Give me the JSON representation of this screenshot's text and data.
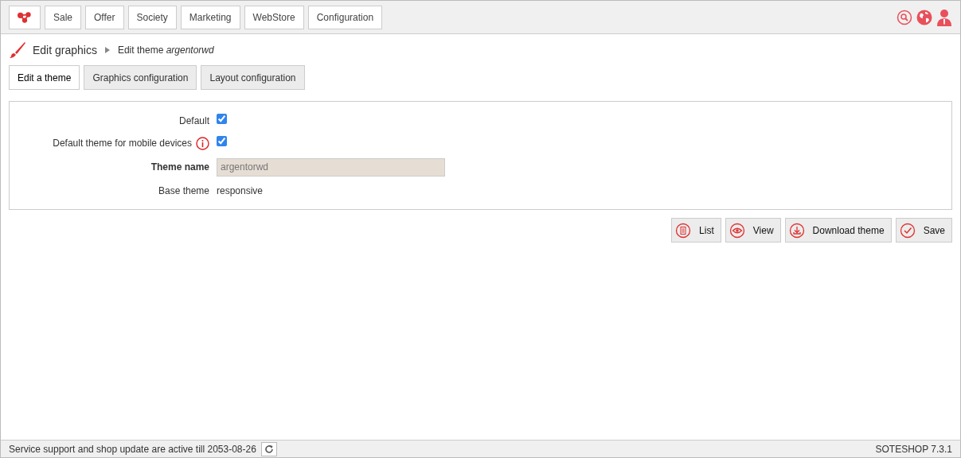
{
  "menu": [
    {
      "label": "Sale"
    },
    {
      "label": "Offer"
    },
    {
      "label": "Society"
    },
    {
      "label": "Marketing"
    },
    {
      "label": "WebStore"
    },
    {
      "label": "Configuration"
    }
  ],
  "breadcrumb": {
    "title": "Edit graphics",
    "current": "Edit theme *argentorwd*"
  },
  "tabs": [
    {
      "label": "Edit a theme",
      "selected": true
    },
    {
      "label": "Graphics configuration",
      "selected": false
    },
    {
      "label": "Layout configuration",
      "selected": false
    }
  ],
  "form": [
    {
      "kind": "checkbox",
      "label": "Default",
      "checked": true
    },
    {
      "kind": "checkbox",
      "label": "Default theme for mobile devices",
      "info": true,
      "checked": true
    },
    {
      "kind": "input",
      "label": "Theme name",
      "value": "argentorwd",
      "disabled": true
    },
    {
      "kind": "text",
      "label": "Base theme",
      "value": "responsive"
    }
  ],
  "actions": [
    {
      "kind": "list",
      "label": "List"
    },
    {
      "kind": "view",
      "label": "View"
    },
    {
      "kind": "download",
      "label": "Download theme"
    },
    {
      "kind": "save",
      "label": "Save"
    }
  ],
  "status_bar": {
    "message": "Service support and shop update are active till 2053-08-26",
    "version": "SOTESHOP 7.3.1"
  }
}
